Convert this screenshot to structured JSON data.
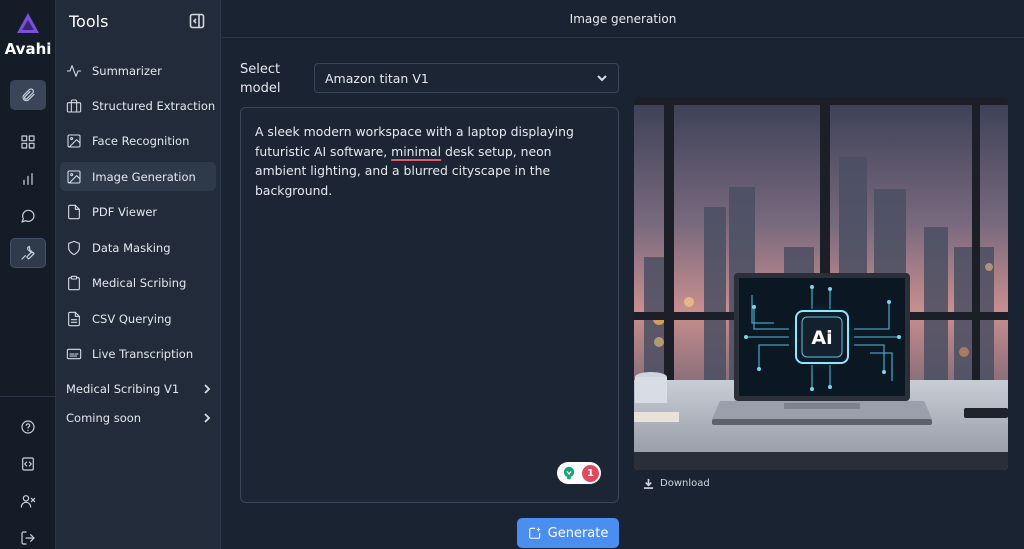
{
  "brand": {
    "name": "Avahi",
    "accent": "#7b4fd6"
  },
  "rail": {
    "icons": [
      "paperclip-icon",
      "grid-icon",
      "bar-chart-icon",
      "chat-icon",
      "wrench-icon",
      "help-icon",
      "code-icon",
      "user-remove-icon",
      "logout-icon"
    ]
  },
  "sidebar": {
    "title": "Tools",
    "items": [
      {
        "label": "Summarizer",
        "icon": "activity-icon"
      },
      {
        "label": "Structured Extraction",
        "icon": "briefcase-icon"
      },
      {
        "label": "Face Recognition",
        "icon": "image-icon"
      },
      {
        "label": "Image Generation",
        "icon": "image-icon",
        "active": true
      },
      {
        "label": "PDF Viewer",
        "icon": "file-icon"
      },
      {
        "label": "Data Masking",
        "icon": "shield-icon"
      },
      {
        "label": "Medical Scribing",
        "icon": "clipboard-icon"
      },
      {
        "label": "CSV Querying",
        "icon": "file-text-icon"
      },
      {
        "label": "Live Transcription",
        "icon": "captions-icon"
      }
    ],
    "groups": [
      {
        "label": "Medical Scribing V1"
      },
      {
        "label": "Coming soon"
      }
    ]
  },
  "header": {
    "title": "Image generation"
  },
  "form": {
    "select_label": "Select model",
    "model_value": "Amazon titan V1",
    "prompt_before": "A sleek modern workspace with a laptop displaying futuristic AI software, ",
    "prompt_flagged": "minimal",
    "prompt_after": " desk setup, neon ambient lighting, and a blurred cityscape in the background.",
    "grammar_count": "1",
    "generate_label": "Generate"
  },
  "output": {
    "laptop_screen_text": "Ai",
    "download_label": "Download"
  }
}
